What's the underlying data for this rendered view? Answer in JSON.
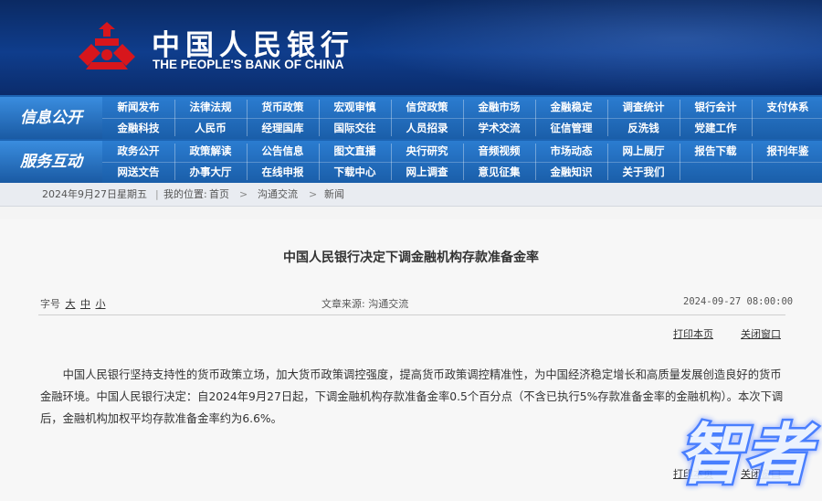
{
  "header": {
    "bank_name_cn": "中国人民银行",
    "bank_name_en": "THE PEOPLE'S BANK OF CHINA"
  },
  "nav": {
    "info_title": "信息公开",
    "service_title": "服务互动",
    "info_row1": [
      "新闻发布",
      "法律法规",
      "货币政策",
      "宏观审慎",
      "信贷政策",
      "金融市场",
      "金融稳定",
      "调查统计",
      "银行会计",
      "支付体系"
    ],
    "info_row2": [
      "金融科技",
      "人民币",
      "经理国库",
      "国际交往",
      "人员招录",
      "学术交流",
      "征信管理",
      "反洗钱",
      "党建工作"
    ],
    "service_row1": [
      "政务公开",
      "政策解读",
      "公告信息",
      "图文直播",
      "央行研究",
      "音频视频",
      "市场动态",
      "网上展厅",
      "报告下载",
      "报刊年鉴"
    ],
    "service_row2": [
      "网送文告",
      "办事大厅",
      "在线申报",
      "下载中心",
      "网上调查",
      "意见征集",
      "金融知识",
      "关于我们"
    ]
  },
  "breadcrumb": {
    "date": "2024年9月27日",
    "weekday": "星期五",
    "location_label": "我的位置:",
    "home": "首页",
    "section": "沟通交流",
    "current": "新闻",
    "sep": ">"
  },
  "article": {
    "title": "中国人民银行决定下调金融机构存款准备金率",
    "font_label": "字号",
    "size_large": "大",
    "size_medium": "中",
    "size_small": "小",
    "source_label": "文章来源:",
    "source": "沟通交流",
    "datetime": "2024-09-27 08:00:00",
    "print_link": "打印本页",
    "close_link": "关闭窗口",
    "body": "中国人民银行坚持支持性的货币政策立场，加大货币政策调控强度，提高货币政策调控精准性，为中国经济稳定增长和高质量发展创造良好的货币金融环境。中国人民银行决定：自2024年9月27日起，下调金融机构存款准备金率0.5个百分点（不含已执行5%存款准备金率的金融机构）。本次下调后，金融机构加权平均存款准备金率约为6.6%。",
    "print_link_bottom": "打印本页",
    "close_link_bottom": "关闭窗口"
  },
  "watermark": {
    "text": "智者"
  },
  "colors": {
    "header_blue": "#0f3d8c",
    "nav_blue": "#1d64b3",
    "logo_red": "#d7161c"
  }
}
